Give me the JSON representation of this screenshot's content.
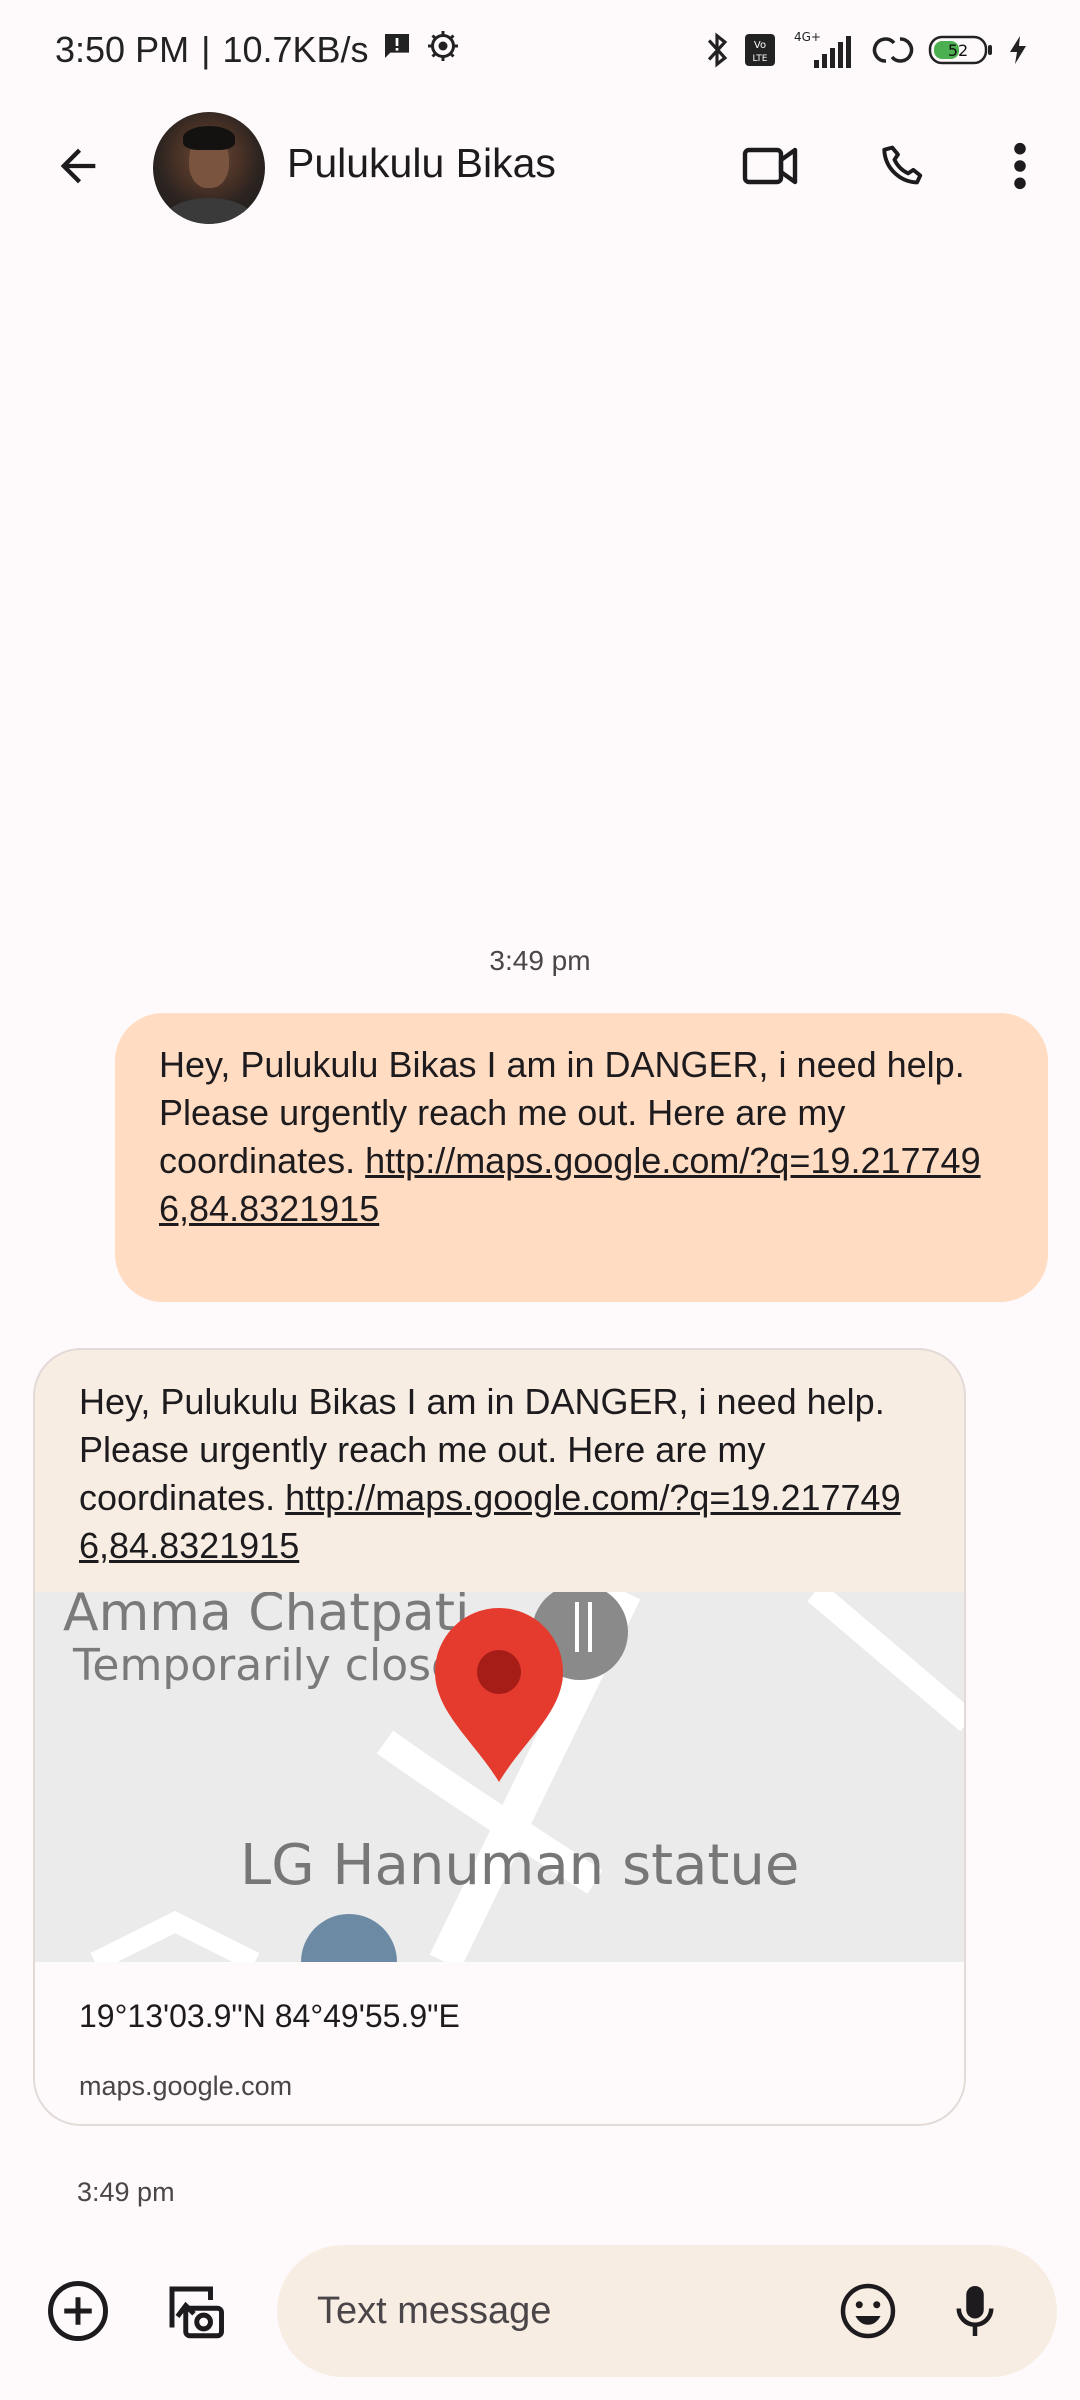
{
  "status_bar": {
    "time": "3:50 PM",
    "separator": "|",
    "net_speed": "10.7KB/s",
    "network_label": "4G+",
    "volte_label": "Vo LTE",
    "battery_level": "52"
  },
  "app_bar": {
    "contact_name": "Pulukulu Bikas"
  },
  "conversation": {
    "time_divider": "3:49 pm",
    "outgoing": {
      "text": "Hey, Pulukulu Bikas I am in DANGER, i need help. Please urgently reach me out. Here are my coordinates.",
      "link": "http://maps.google.com/?q=19.2177496,84.8321915"
    },
    "incoming": {
      "text": "Hey, Pulukulu Bikas I am in DANGER, i need help. Please urgently reach me out. Here are my coordinates.",
      "link": "http://maps.google.com/?q=19.2177496,84.8321915",
      "map": {
        "place_1": "Amma Chatpati",
        "place_1_status": "Temporarily closed",
        "place_2": "LG Hanuman statue",
        "coords": "19°13'03.9\"N 84°49'55.9\"E",
        "domain": "maps.google.com"
      },
      "time": "3:49 pm"
    }
  },
  "compose": {
    "placeholder": "Text message"
  },
  "colors": {
    "outgoing_bubble": "#ffdcc2",
    "incoming_bubble": "#f7ede3",
    "background": "#fefafb",
    "map_pin": "#e53b2f"
  }
}
